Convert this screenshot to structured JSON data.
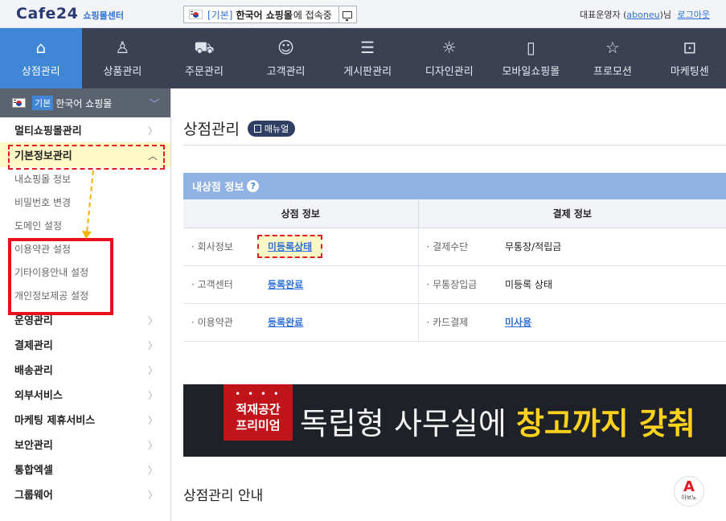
{
  "topbar": {
    "logo_main": "Cafe24",
    "logo_sub": "쇼핑몰센터",
    "shop_tag": "[기본]",
    "shop_name": "한국어 쇼핑몰",
    "shop_suffix": "에 접속중",
    "user_prefix": "대표운영자 (",
    "user_id": "aboneu",
    "user_suffix": ")님",
    "logout": "로그아웃"
  },
  "gnb": [
    {
      "label": "상점관리",
      "icon": "home-icon",
      "glyph": "⌂"
    },
    {
      "label": "상품관리",
      "icon": "tshirt-icon",
      "glyph": "♙"
    },
    {
      "label": "주문관리",
      "icon": "cart-icon",
      "glyph": "⛟"
    },
    {
      "label": "고객관리",
      "icon": "users-icon",
      "glyph": "☺"
    },
    {
      "label": "게시판관리",
      "icon": "board-icon",
      "glyph": "☰"
    },
    {
      "label": "디자인관리",
      "icon": "palette-icon",
      "glyph": "☼"
    },
    {
      "label": "모바일쇼핑몰",
      "icon": "mobile-icon",
      "glyph": "▯"
    },
    {
      "label": "프로모션",
      "icon": "star-icon",
      "glyph": "☆"
    },
    {
      "label": "마케팅센",
      "icon": "marketing-icon",
      "glyph": "⊡"
    }
  ],
  "sidebar": {
    "shop_badge": "기본",
    "shop_name": "한국어 쇼핑몰",
    "items_top": [
      {
        "label": "멀티쇼핑몰관리"
      },
      {
        "label": "기본정보관리"
      }
    ],
    "sub_items": [
      {
        "label": "내쇼핑몰 정보"
      },
      {
        "label": "비밀번호 변경"
      },
      {
        "label": "도메인 설정"
      },
      {
        "label": "이용약관 설정"
      },
      {
        "label": "기타이용안내 설정"
      },
      {
        "label": "개인정보제공 설정"
      }
    ],
    "items_bottom": [
      {
        "label": "운영관리"
      },
      {
        "label": "결제관리"
      },
      {
        "label": "배송관리"
      },
      {
        "label": "외부서비스"
      },
      {
        "label": "마케팅 제휴서비스"
      },
      {
        "label": "보안관리"
      },
      {
        "label": "통합엑셀"
      },
      {
        "label": "그룹웨어"
      }
    ]
  },
  "page": {
    "title": "상점관리",
    "manual": "매뉴얼"
  },
  "info": {
    "title": "내상점 정보",
    "help": "?",
    "col_left": "상점 정보",
    "col_right": "결제 정보",
    "rows": [
      {
        "l_label": "· 회사정보",
        "l_value": "미등록상태",
        "r_label": "· 결제수단",
        "r_value": "무통장/적립금"
      },
      {
        "l_label": "· 고객센터",
        "l_value": "등록완료",
        "r_label": "· 무통장입금",
        "r_value": "미등록 상태"
      },
      {
        "l_label": "· 이용약관",
        "l_value": "등록완료",
        "r_label": "· 카드결제",
        "r_value": "미사용"
      }
    ]
  },
  "banner": {
    "dots": "• • • •",
    "badge_line1": "적재공간",
    "badge_line2": "프리미엄",
    "text_plain": "독립형 사무실에 ",
    "text_emph": "창고까지 갖춰"
  },
  "guide": {
    "title": "상점관리 안내",
    "abono_glyph": "A",
    "abono_text": "아보노"
  },
  "colors": {
    "gnb_bg": "#3b4153",
    "gnb_active": "#3f86d6",
    "highlight_red": "#e8101a",
    "link_blue": "#2f6fd7"
  }
}
